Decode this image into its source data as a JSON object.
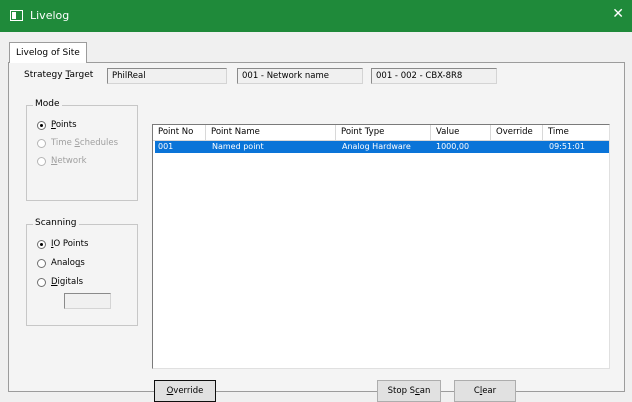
{
  "window": {
    "title": "Livelog",
    "close": "✕"
  },
  "tab": {
    "label": "Livelog of Site"
  },
  "strategy": {
    "label": "Strategy Target",
    "site": "PhilReal",
    "network": "001 - Network name",
    "device": "001 - 002 - CBX-8R8"
  },
  "mode": {
    "title": "Mode",
    "options": [
      {
        "label": "Points",
        "checked": true,
        "enabled": true
      },
      {
        "label": "Time Schedules",
        "checked": false,
        "enabled": false
      },
      {
        "label": "Network",
        "checked": false,
        "enabled": false
      }
    ]
  },
  "scanning": {
    "title": "Scanning",
    "options": [
      {
        "label": "IO Points",
        "checked": true
      },
      {
        "label": "Analogs",
        "checked": false
      },
      {
        "label": "Digitals",
        "checked": false
      }
    ],
    "digitals_value": ""
  },
  "table": {
    "columns": [
      "Point No",
      "Point Name",
      "Point Type",
      "Value",
      "Override",
      "Time"
    ],
    "rows": [
      {
        "point_no": "001",
        "point_name": "Named point",
        "point_type": "Analog Hardware",
        "value": "1000,00",
        "override": "",
        "time": "09:51:01",
        "selected": true
      }
    ]
  },
  "buttons": {
    "override": "Override",
    "stop_scan": "Stop Scan",
    "clear": "Clear"
  },
  "colors": {
    "titlebar": "#1f8a3a",
    "selection": "#0a74d8"
  }
}
